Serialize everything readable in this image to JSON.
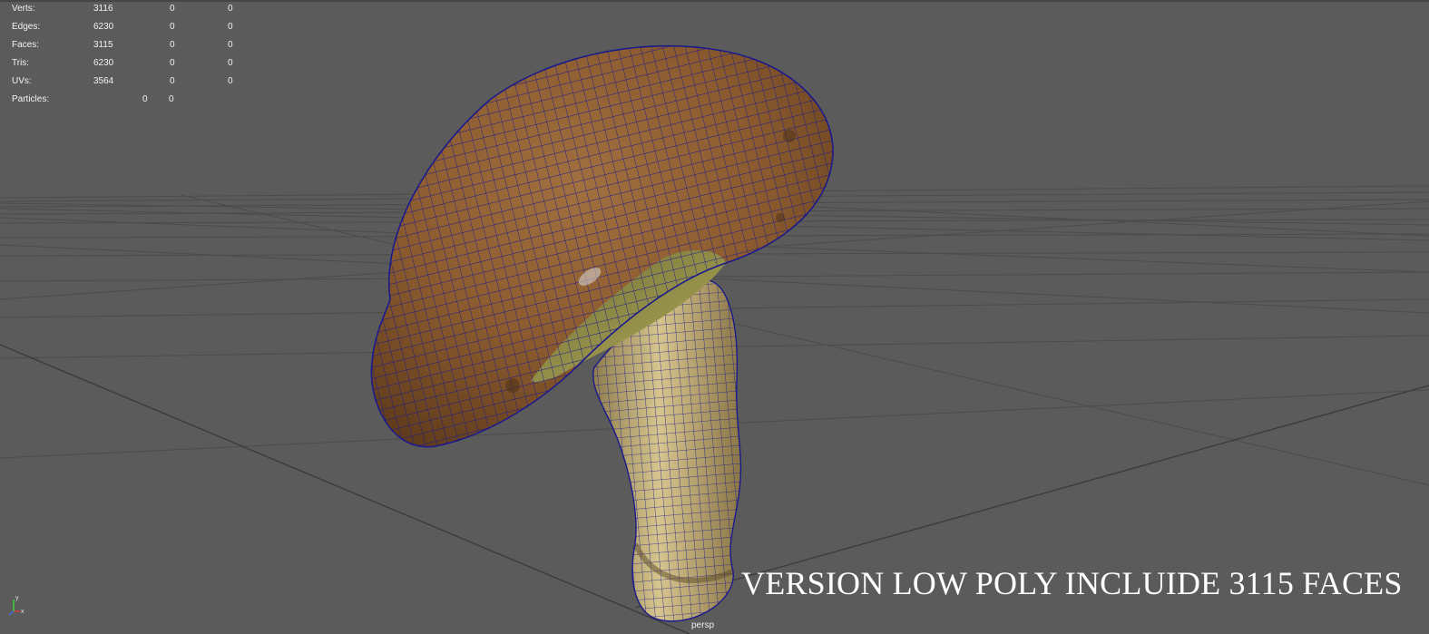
{
  "hud": {
    "stats": [
      {
        "label": "Verts:",
        "total": "3116",
        "selected": "0",
        "component": "0"
      },
      {
        "label": "Edges:",
        "total": "6230",
        "selected": "0",
        "component": "0"
      },
      {
        "label": "Faces:",
        "total": "3115",
        "selected": "0",
        "component": "0"
      },
      {
        "label": "Tris:",
        "total": "6230",
        "selected": "0",
        "component": "0"
      },
      {
        "label": "UVs:",
        "total": "3564",
        "selected": "0",
        "component": "0"
      }
    ],
    "particles": {
      "label": "Particles:",
      "selected": "0",
      "component": "0"
    }
  },
  "caption": "VERSION LOW POLY INCLUIDE 3115 FACES",
  "camera": "persp",
  "axis_gizmo": {
    "x_label": "x",
    "y_label": "y",
    "icon": "axis-gizmo-icon"
  },
  "colors": {
    "background": "#5b5b5b",
    "grid": "#4a4a4a",
    "wireframe": "#1a1a8c",
    "cap": "#8a5a2e",
    "stem": "#c9b47a",
    "gills": "#9a9448"
  }
}
